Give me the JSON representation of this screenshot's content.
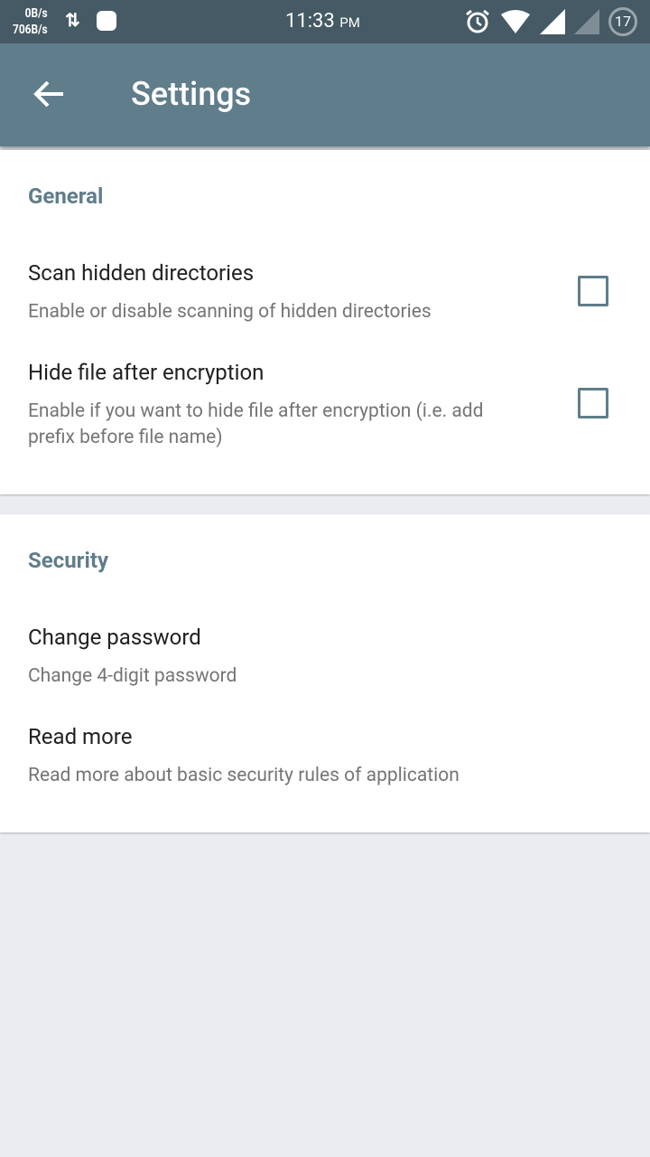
{
  "status_bar": {
    "net_up": "0B/s",
    "net_down": "706B/s",
    "time": "11:33",
    "ampm": "PM",
    "battery": "17"
  },
  "app_bar": {
    "title": "Settings"
  },
  "general": {
    "header": "General",
    "items": [
      {
        "title": "Scan hidden directories",
        "summary": "Enable or disable scanning of hidden directories",
        "checked": false
      },
      {
        "title": "Hide file after encryption",
        "summary": "Enable if you want to hide file after encryption (i.e. add prefix before file name)",
        "checked": false
      }
    ]
  },
  "security": {
    "header": "Security",
    "items": [
      {
        "title": "Change password",
        "summary": "Change 4-digit password"
      },
      {
        "title": "Read more",
        "summary": "Read more about basic security rules of application"
      }
    ]
  },
  "colors": {
    "primary": "#607d8b",
    "status": "#455a64"
  }
}
